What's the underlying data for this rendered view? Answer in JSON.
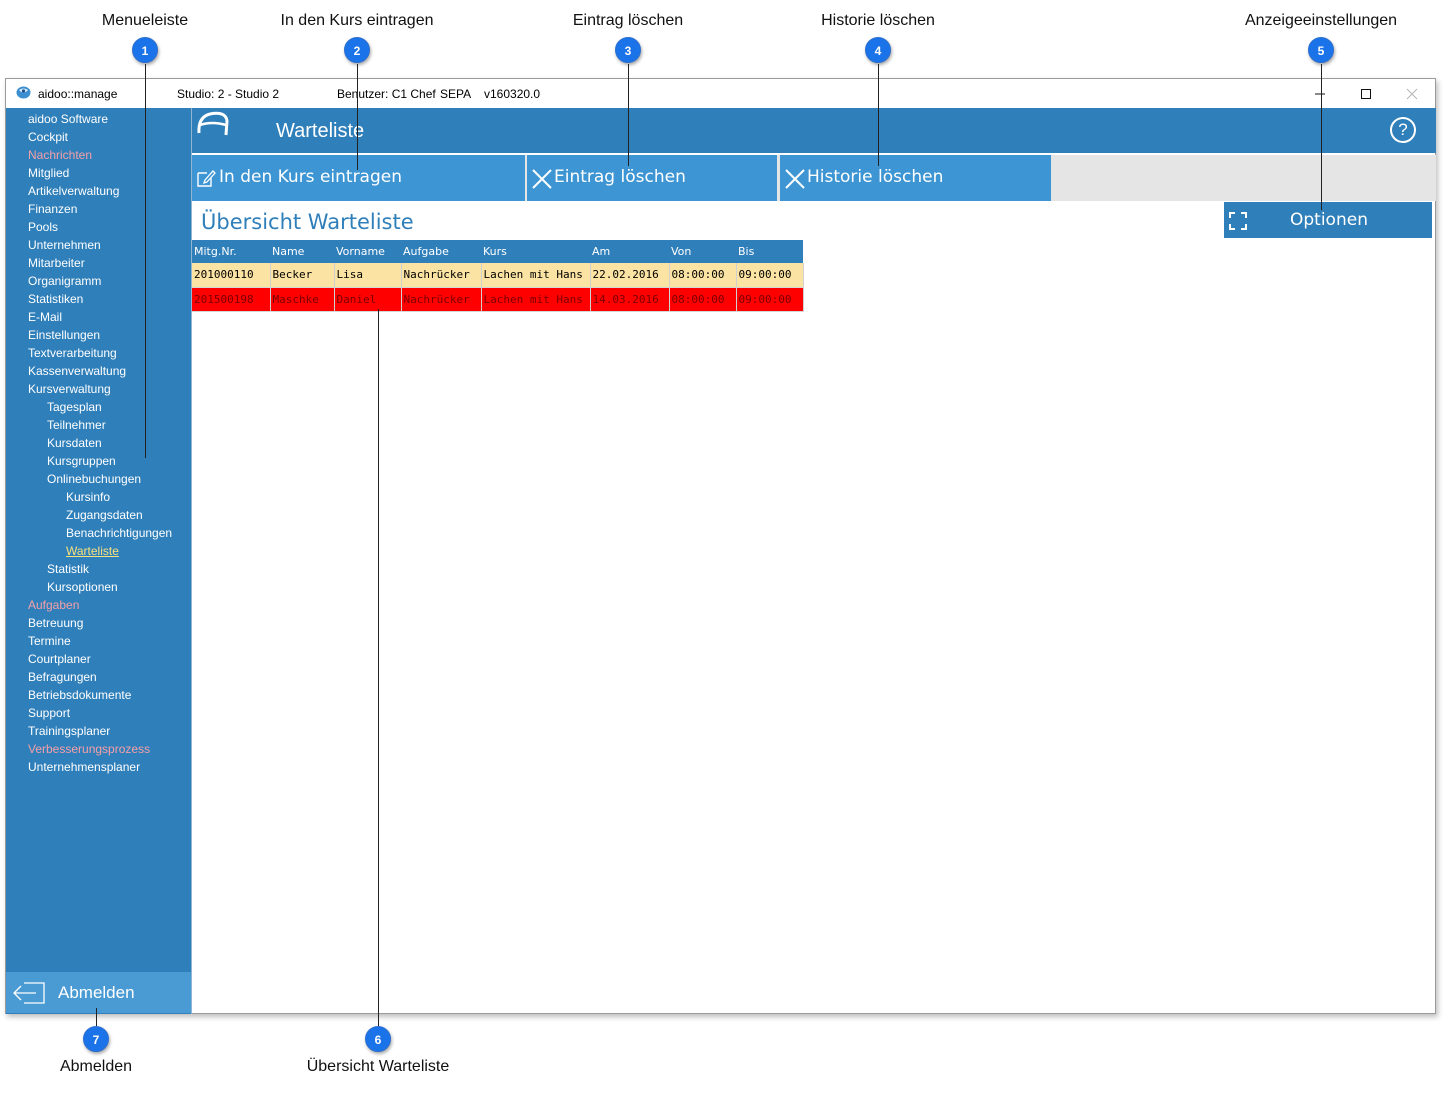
{
  "annotations": [
    {
      "n": "1",
      "label": "Menueleiste"
    },
    {
      "n": "2",
      "label": "In den Kurs eintragen"
    },
    {
      "n": "3",
      "label": "Eintrag löschen"
    },
    {
      "n": "4",
      "label": "Historie löschen"
    },
    {
      "n": "5",
      "label": "Anzeigeeinstellungen"
    },
    {
      "n": "6",
      "label": "Übersicht Warteliste"
    },
    {
      "n": "7",
      "label": "Abmelden"
    }
  ],
  "titlebar": {
    "app": "aidoo::manage",
    "studio": "Studio: 2 - Studio 2",
    "user": "Benutzer: C1 Chef",
    "sepa": "SEPA",
    "version": "v160320.0"
  },
  "sidebar": {
    "items": [
      {
        "label": "aidoo Software",
        "level": 1,
        "state": "normal"
      },
      {
        "label": "Cockpit",
        "level": 1,
        "state": "normal"
      },
      {
        "label": "Nachrichten",
        "level": 1,
        "state": "dim"
      },
      {
        "label": "Mitglied",
        "level": 1,
        "state": "normal"
      },
      {
        "label": "Artikelverwaltung",
        "level": 1,
        "state": "normal"
      },
      {
        "label": "Finanzen",
        "level": 1,
        "state": "normal"
      },
      {
        "label": "Pools",
        "level": 1,
        "state": "normal"
      },
      {
        "label": "Unternehmen",
        "level": 1,
        "state": "normal"
      },
      {
        "label": "Mitarbeiter",
        "level": 1,
        "state": "normal"
      },
      {
        "label": "Organigramm",
        "level": 1,
        "state": "normal"
      },
      {
        "label": "Statistiken",
        "level": 1,
        "state": "normal"
      },
      {
        "label": "E-Mail",
        "level": 1,
        "state": "normal"
      },
      {
        "label": "Einstellungen",
        "level": 1,
        "state": "normal"
      },
      {
        "label": "Textverarbeitung",
        "level": 1,
        "state": "normal"
      },
      {
        "label": "Kassenverwaltung",
        "level": 1,
        "state": "normal"
      },
      {
        "label": "Kursverwaltung",
        "level": 1,
        "state": "normal"
      },
      {
        "label": "Tagesplan",
        "level": 2,
        "state": "normal"
      },
      {
        "label": "Teilnehmer",
        "level": 2,
        "state": "normal"
      },
      {
        "label": "Kursdaten",
        "level": 2,
        "state": "normal"
      },
      {
        "label": "Kursgruppen",
        "level": 2,
        "state": "normal"
      },
      {
        "label": "Onlinebuchungen",
        "level": 2,
        "state": "normal"
      },
      {
        "label": "Kursinfo",
        "level": 3,
        "state": "normal"
      },
      {
        "label": "Zugangsdaten",
        "level": 3,
        "state": "normal"
      },
      {
        "label": "Benachrichtigungen",
        "level": 3,
        "state": "normal"
      },
      {
        "label": "Warteliste",
        "level": 3,
        "state": "active"
      },
      {
        "label": "Statistik",
        "level": 2,
        "state": "normal"
      },
      {
        "label": "Kursoptionen",
        "level": 2,
        "state": "normal"
      },
      {
        "label": "Aufgaben",
        "level": 1,
        "state": "dim"
      },
      {
        "label": "Betreuung",
        "level": 1,
        "state": "normal"
      },
      {
        "label": "Termine",
        "level": 1,
        "state": "normal"
      },
      {
        "label": "Courtplaner",
        "level": 1,
        "state": "normal"
      },
      {
        "label": "Befragungen",
        "level": 1,
        "state": "normal"
      },
      {
        "label": "Betriebsdokumente",
        "level": 1,
        "state": "normal"
      },
      {
        "label": "Support",
        "level": 1,
        "state": "normal"
      },
      {
        "label": "Trainingsplaner",
        "level": 1,
        "state": "normal"
      },
      {
        "label": "Verbesserungsprozess",
        "level": 1,
        "state": "dim"
      },
      {
        "label": "Unternehmensplaner",
        "level": 1,
        "state": "normal"
      }
    ],
    "logout_label": "Abmelden"
  },
  "header": {
    "title": "Warteliste",
    "help": "?"
  },
  "toolbar": {
    "enroll_label": "In den Kurs eintragen",
    "delete_label": "Eintrag löschen",
    "history_label": "Historie löschen"
  },
  "content": {
    "title": "Übersicht Warteliste",
    "options_label": "Optionen"
  },
  "table": {
    "columns": [
      "Mitg.Nr.",
      "Name",
      "Vorname",
      "Aufgabe",
      "Kurs",
      "Am",
      "Von",
      "Bis"
    ],
    "rows": [
      {
        "cells": [
          "201000110",
          "Becker",
          "Lisa",
          "Nachrücker",
          "Lachen mit Hans",
          "22.02.2016",
          "08:00:00",
          "09:00:00"
        ],
        "style": "row-a"
      },
      {
        "cells": [
          "201500198",
          "Maschke",
          "Daniel",
          "Nachrücker",
          "Lachen mit Hans",
          "14.03.2016",
          "08:00:00",
          "09:00:00"
        ],
        "style": "row-b"
      }
    ]
  },
  "colors": {
    "primary": "#2f7fba",
    "button": "#3d95d3",
    "row_highlight": "#fbe3a3",
    "row_alert": "#ff0000",
    "menu_dim": "#f4a0a8",
    "menu_active": "#f7e27c"
  }
}
